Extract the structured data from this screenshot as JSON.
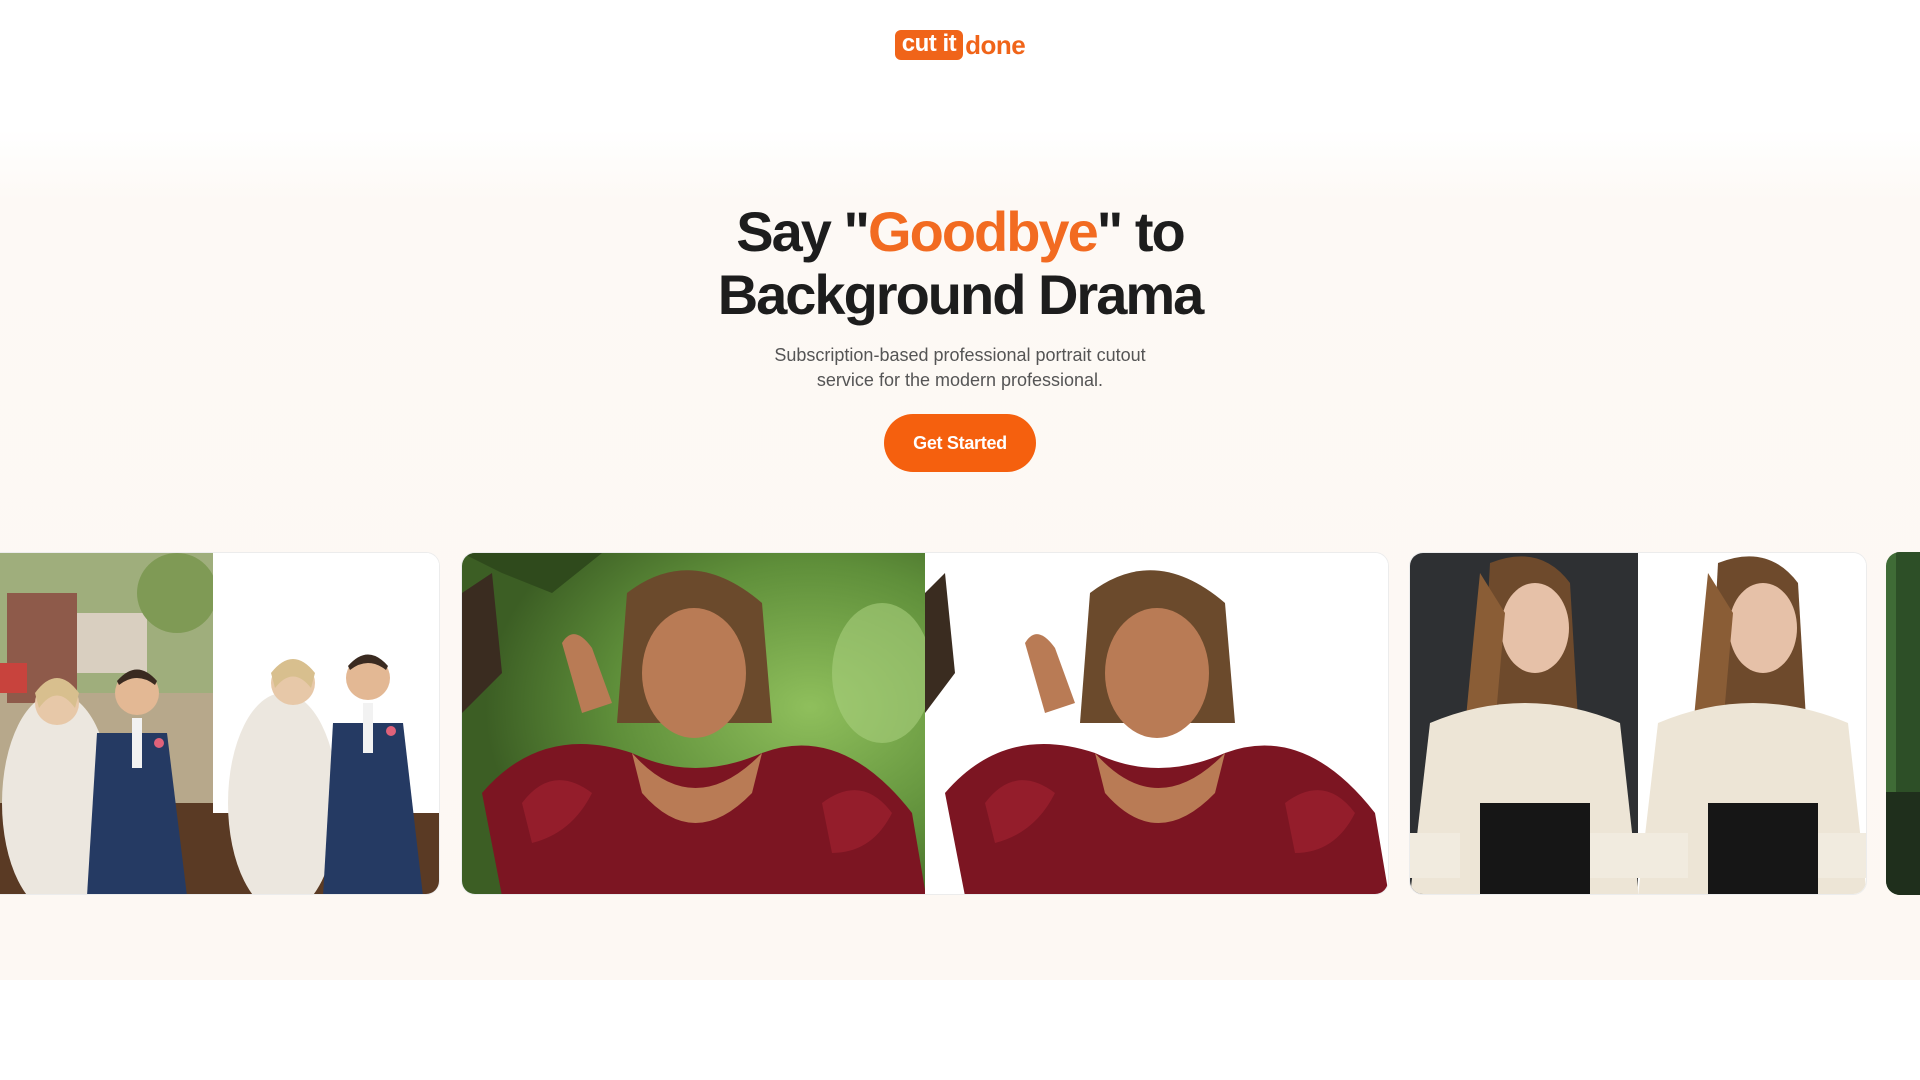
{
  "brand": {
    "logo_box": "cut it",
    "logo_text": "done",
    "accent": "#f26b21"
  },
  "hero": {
    "headline_pre": "Say \"",
    "headline_accent": "Goodbye",
    "headline_post": "\" to",
    "headline_line2": "Background Drama",
    "subtext_line1": "Subscription-based professional portrait cutout",
    "subtext_line2": "service for the modern professional.",
    "cta_label": "Get Started"
  },
  "carousel": {
    "cards": [
      {
        "subject": "wedding couple",
        "before_bg": "outdoor",
        "after_bg": "white"
      },
      {
        "subject": "woman in red tulle dress",
        "before_bg": "green foliage",
        "after_bg": "white"
      },
      {
        "subject": "woman in cream blouse",
        "before_bg": "dark grey studio",
        "after_bg": "white"
      }
    ]
  }
}
